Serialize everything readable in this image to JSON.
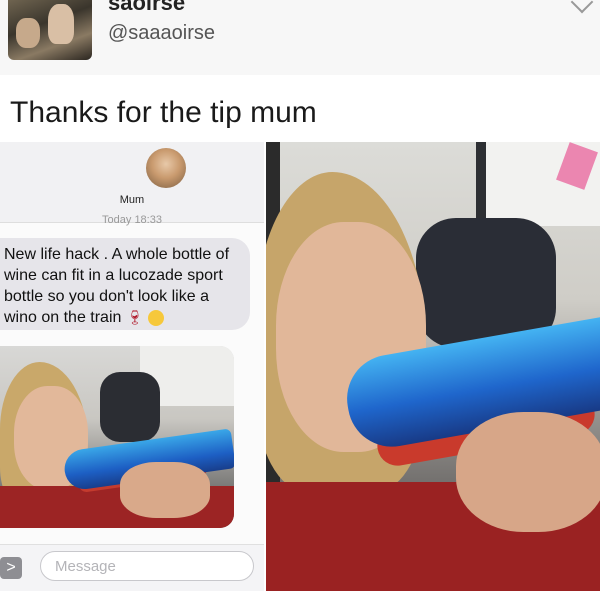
{
  "tweet": {
    "name": "saoirse",
    "handle": "@saaaoirse",
    "text": "Thanks for the tip mum"
  },
  "imessage": {
    "contact_name": "Mum",
    "timestamp": "Today 18:33",
    "message": "New life hack . A whole bottle of wine can fit in a lucozade sport bottle so you don't look like a wino on the train",
    "emojis": [
      "wine-glass-emoji",
      "halo-face-emoji"
    ],
    "input_placeholder": "Message",
    "expand_glyph": ">"
  },
  "colors": {
    "bubble_grey": "#e6e5ea",
    "bottle_blue": "#1f66cc",
    "wine_red": "#c93a2c"
  }
}
